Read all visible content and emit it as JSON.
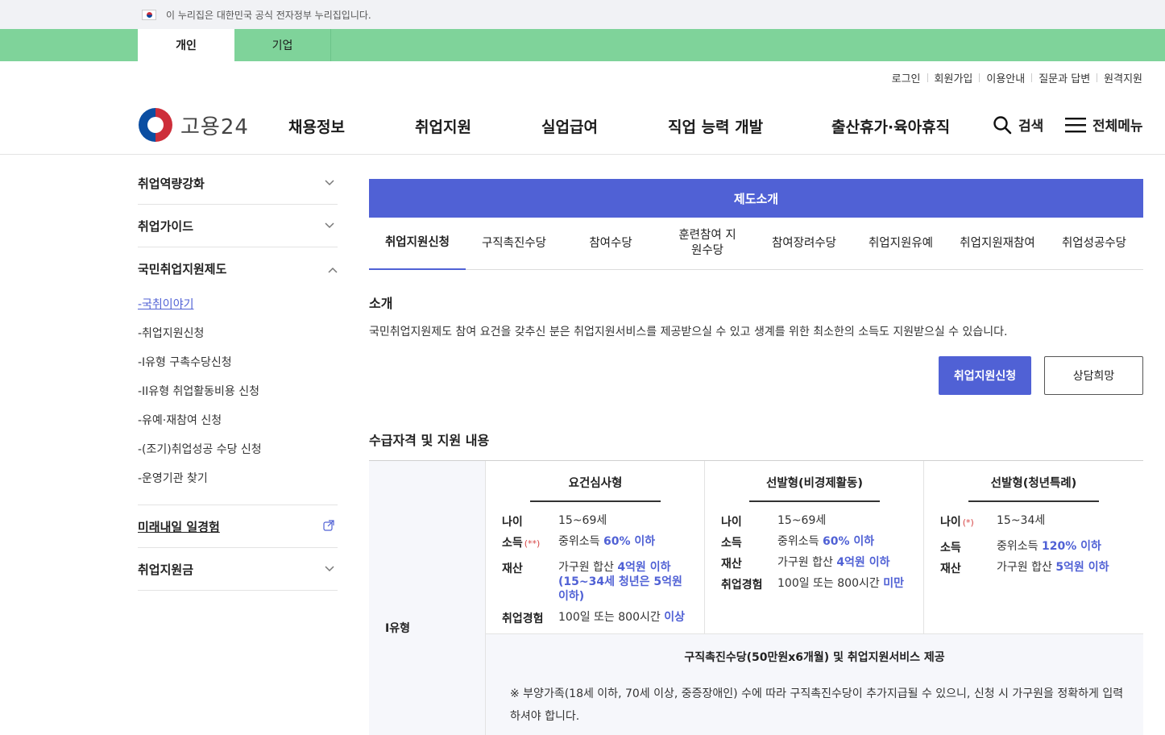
{
  "gov_banner": {
    "text": "이 누리집은 대한민국 공식 전자정부 누리집입니다."
  },
  "user_type_tabs": [
    {
      "label": "개인"
    },
    {
      "label": "기업"
    }
  ],
  "util_links": [
    "로그인",
    "회원가입",
    "이용안내",
    "질문과 답변",
    "원격지원"
  ],
  "header": {
    "logo_text": "고용24",
    "nav": [
      "채용정보",
      "취업지원",
      "실업급여",
      "직업 능력 개발",
      "출산휴가·육아휴직"
    ],
    "search_label": "검색",
    "menu_label": "전체메뉴"
  },
  "sidebar": {
    "items": [
      {
        "label": "취업역량강화"
      },
      {
        "label": "취업가이드"
      },
      {
        "label": "국민취업지원제도"
      },
      {
        "label": "미래내일 일경험"
      },
      {
        "label": "취업지원금"
      }
    ],
    "subitems": [
      "-국취이야기",
      "-취업지원신청",
      "-I유형 구촉수당신청",
      "-II유형 취업활동비용 신청",
      "-유예·재참여 신청",
      "-(조기)취업성공 수당 신청",
      "-운영기관 찾기"
    ]
  },
  "main": {
    "title": "제도소개",
    "tabs": [
      "취업지원신청",
      "구직촉진수당",
      "참여수당",
      "훈련참여 지원수당",
      "참여장려수당",
      "취업지원유예",
      "취업지원재참여",
      "취업성공수당"
    ],
    "intro_heading": "소개",
    "intro_text": "국민취업지원제도 참여 요건을 갖추신 분은 취업지원서비스를 제공받으실 수 있고 생계를 위한 최소한의 소득도 지원받으실 수 있습니다.",
    "apply_button": "취업지원신청",
    "consult_button": "상담희망",
    "eligibility_heading": "수급자격 및 지원 내용"
  },
  "table": {
    "row_header": "I유형",
    "columns": [
      {
        "title": "요건심사형",
        "age_label": "나이",
        "age": "15~69세",
        "income_label": "소득",
        "income_mark": "(**)",
        "income_text": "중위소득 ",
        "income_hl": "60% 이하",
        "asset_label": "재산",
        "asset_text": "가구원 합산 ",
        "asset_hl": "4억원 이하",
        "asset_extra": "(15~34세 청년은 5억원 이하)",
        "exp_label": "취업경험",
        "exp_text": "100일 또는 800시간 ",
        "exp_hl": "이상"
      },
      {
        "title": "선발형(비경제활동)",
        "age_label": "나이",
        "age": "15~69세",
        "income_label": "소득",
        "income_text": "중위소득 ",
        "income_hl": "60% 이하",
        "asset_label": "재산",
        "asset_text": "가구원 합산 ",
        "asset_hl": "4억원 이하",
        "exp_label": "취업경험",
        "exp_text": "100일 또는 800시간 ",
        "exp_hl": "미만"
      },
      {
        "title": "선발형(청년특례)",
        "age_label": "나이",
        "age_mark": "(*)",
        "age": "15~34세",
        "income_label": "소득",
        "income_text": "중위소득 ",
        "income_hl": "120% 이하",
        "asset_label": "재산",
        "asset_text": "가구원 합산 ",
        "asset_hl": "5억원 이하"
      }
    ],
    "footer_title": "구직촉진수당(50만원x6개월) 및 취업지원서비스 제공",
    "footer_note": "※ 부양가족(18세 이하, 70세 이상, 중증장애인) 수에 따라 구직촉진수당이 추가지급될 수 있으니, 신청 시 가구원을 정확하게 입력하셔야 합니다."
  },
  "colors": {
    "accent": "#5061d5",
    "green_bar": "#7fd39a"
  }
}
